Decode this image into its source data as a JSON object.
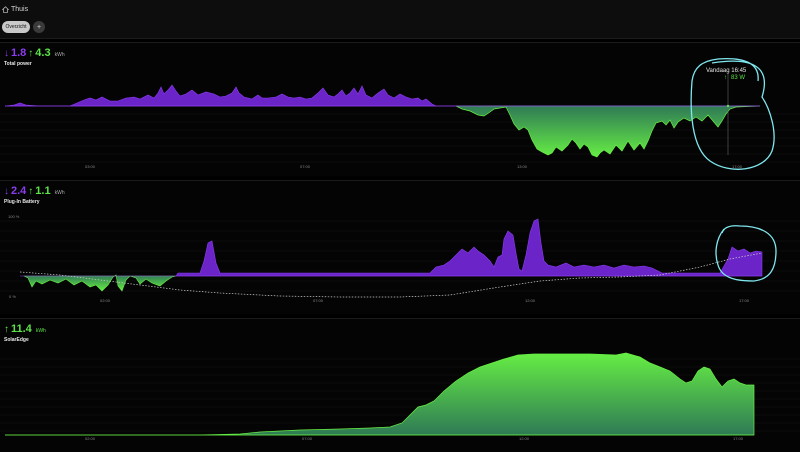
{
  "header": {
    "home_label": "Thuis",
    "tabs": [
      {
        "label": "Overzicht"
      }
    ],
    "add_label": "+"
  },
  "panels": [
    {
      "title": "Total power",
      "import_value": "1.8",
      "export_value": "4.3",
      "unit": "kWh",
      "x_ticks": [
        "03:00",
        "07:00",
        "13:00",
        "17:00"
      ],
      "tooltip": {
        "time": "Vandaag 16:45",
        "value": "83 W"
      }
    },
    {
      "title": "Plug-In Battery",
      "import_value": "2.4",
      "export_value": "1.1",
      "unit": "kWh",
      "y_top_label": "100 %",
      "y_bottom_label": "0 %",
      "x_ticks": [
        "02:00",
        "07:00",
        "12:00",
        "17:00"
      ]
    },
    {
      "title": "SolarEdge",
      "export_value": "11.4",
      "unit": "kWh",
      "x_ticks": [
        "02:00",
        "07:00",
        "12:00",
        "17:00"
      ]
    }
  ],
  "colors": {
    "consumption": "#7a2fd6",
    "production": "#5de24a",
    "annotation": "#7fe7ee"
  }
}
